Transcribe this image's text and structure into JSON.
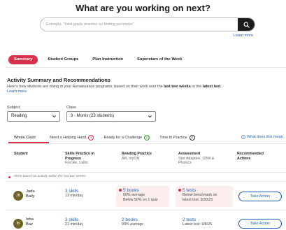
{
  "header": {
    "title": "What are you working on next?",
    "search_placeholder": "Example: \"third grade practice on finding perimeter\"",
    "learn_more": "Learn more"
  },
  "tabs": [
    {
      "label": "Summary",
      "active": true
    },
    {
      "label": "Student Groups",
      "active": false
    },
    {
      "label": "Plan Instruction",
      "active": false
    },
    {
      "label": "Superstars of the Week",
      "active": false
    }
  ],
  "summary": {
    "title": "Activity Summary and Recommendations",
    "desc_prefix": "Here's how students are doing in your Renaissance programs, based on their work over the ",
    "desc_bold1": "last two weeks",
    "desc_mid": " or the ",
    "desc_bold2": "latest test",
    "desc_suffix": ".",
    "learn_more": "Learn more"
  },
  "filters": {
    "subject_label": "Subject",
    "subject_value": "Reading",
    "class_label": "Class",
    "class_value": "3 - Morris (23 students)"
  },
  "subtabs": [
    {
      "label": "Whole Class",
      "count": null,
      "color": null
    },
    {
      "label": "Need a Helping Hand",
      "count": "5",
      "color": "red"
    },
    {
      "label": "Ready for a Challenge",
      "count": "13",
      "color": "green"
    },
    {
      "label": "Time to Practice",
      "count": "0",
      "color": "gray"
    }
  ],
  "what_does_this_mean": "What does this mean",
  "table": {
    "headers": {
      "student": "Student",
      "skills": "Skills Practice in Progress",
      "skills_sub": "Freckle, Lalilo",
      "reading": "Reading Practice",
      "reading_sub": "AR, myON",
      "assessment": "Assessment",
      "assessment_sub": "Star Adaptive, CBM & Phonics",
      "recommended": "Recommended Actions"
    },
    "alert_note": "Alerts based on activity within the last two weeks",
    "rows": [
      {
        "initials": "JB",
        "first": "Jada",
        "last": "Baily",
        "skills": "3 skills",
        "skills_sub": "13 min/day",
        "reading": "5 books",
        "reading_sub1": "60% average",
        "reading_sub2": "Below 50% on 1 quiz",
        "reading_alert": true,
        "assessment": "5 tests",
        "assessment_sub1": "Below benchmark on",
        "assessment_sub2": "latest test: 9/30/25",
        "assessment_alert": true,
        "action": "Take Action"
      },
      {
        "initials": "IB",
        "first": "Isha",
        "last": "Baz",
        "skills": "3 skills",
        "skills_sub": "21 min/day",
        "reading": "2 books",
        "reading_sub1": "90% average",
        "reading_sub2": "",
        "reading_alert": false,
        "assessment": "2 tests",
        "assessment_sub1": "Latest test: 9/8/25",
        "assessment_sub2": "",
        "assessment_alert": false,
        "action": "Take Action"
      }
    ]
  },
  "colors": {
    "accent": "#d9304b",
    "link": "#1a5fb4",
    "search_button": "#1c1c1c",
    "alert_bg": "#fdeeee",
    "avatar": "#6e6324"
  }
}
